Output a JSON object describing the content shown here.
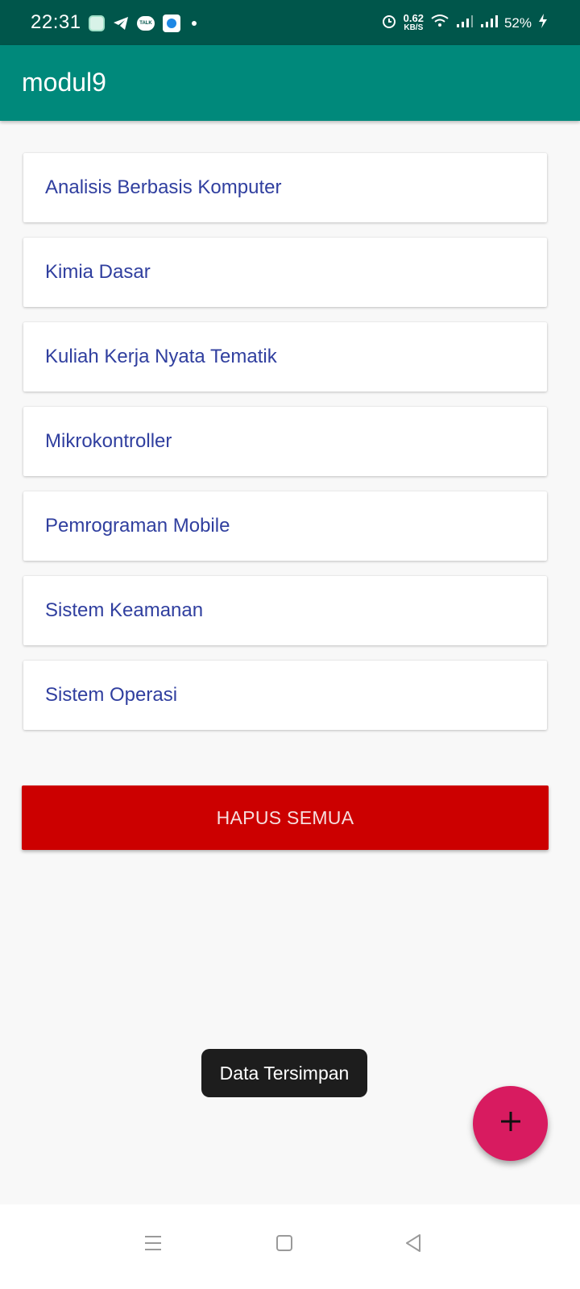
{
  "status_bar": {
    "time": "22:31",
    "net_speed_value": "0.62",
    "net_speed_unit": "KB/S",
    "battery": "52%",
    "icons": [
      "chat-app-icon",
      "telegram-icon",
      "talk-icon",
      "browser-icon",
      "notification-dot",
      "alarm-icon",
      "wifi-icon",
      "signal-icon",
      "signal-icon",
      "charging-icon"
    ]
  },
  "app_bar": {
    "title": "modul9"
  },
  "list": {
    "items": [
      {
        "label": "Analisis Berbasis Komputer"
      },
      {
        "label": "Kimia Dasar"
      },
      {
        "label": "Kuliah Kerja Nyata Tematik"
      },
      {
        "label": "Mikrokontroller"
      },
      {
        "label": "Pemrograman Mobile"
      },
      {
        "label": "Sistem Keamanan"
      },
      {
        "label": "Sistem Operasi"
      }
    ]
  },
  "delete_button": {
    "label": "HAPUS SEMUA",
    "color": "#cc0000"
  },
  "toast": {
    "message": "Data Tersimpan"
  },
  "fab": {
    "icon": "plus-icon",
    "color": "#d81b60"
  },
  "nav_bar": {
    "buttons": [
      "menu-icon",
      "home-icon",
      "back-icon"
    ]
  },
  "colors": {
    "status_bar": "#00564b",
    "app_bar": "#00897b",
    "item_text": "#303f9f"
  }
}
